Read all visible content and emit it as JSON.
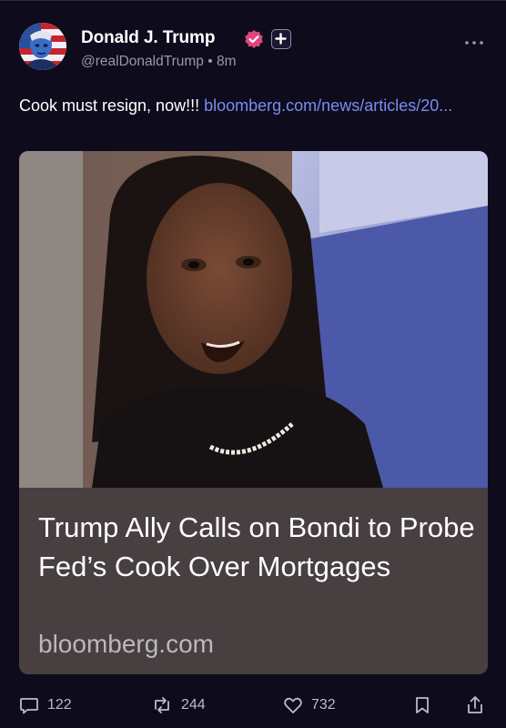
{
  "author": {
    "name": "Donald J. Trump",
    "handle": "@realDonaldTrump",
    "time": "8m"
  },
  "icons": {
    "avatar": "avatar-portrait",
    "verified": "verified-badge-icon",
    "follow": "plus-icon",
    "more": "more-horizontal-icon",
    "reply": "comment-icon",
    "repost": "repost-icon",
    "like": "heart-icon",
    "bookmark": "bookmark-icon",
    "share": "share-icon"
  },
  "post": {
    "text": "Cook must resign, now!!!",
    "link_text": "bloomberg.com/news/articles/20..."
  },
  "card": {
    "title": "Trump Ally Calls on Bondi to Probe Fed’s Cook Over Mortgages",
    "domain": "bloomberg.com"
  },
  "actions": {
    "replies": "122",
    "reposts": "244",
    "likes": "732"
  },
  "colors": {
    "background": "#0d0b1c",
    "link": "#7b8cf0",
    "verified_badge": "#e0467c",
    "card_background": "#473f40"
  }
}
